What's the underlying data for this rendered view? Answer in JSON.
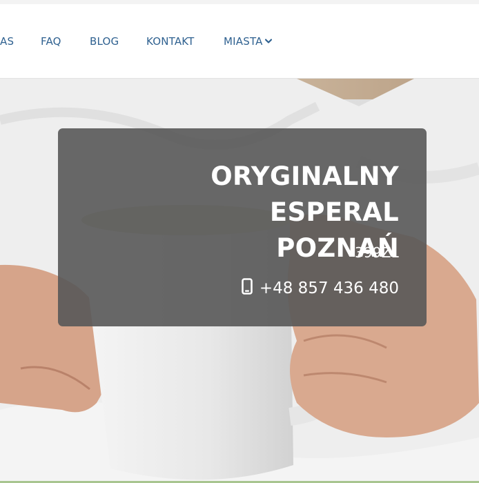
{
  "nav": {
    "items": [
      {
        "label": "AS"
      },
      {
        "label": "FAQ"
      },
      {
        "label": "BLOG"
      },
      {
        "label": "KONTAKT"
      },
      {
        "label": "MIASTA"
      }
    ]
  },
  "hero": {
    "title_line1": "ORYGINALNY ESPERAL",
    "title_line2": "POZNAŃ",
    "price": "399ZŁ",
    "phone": "+48 857 436 480"
  },
  "colors": {
    "nav_link": "#2f6190",
    "card_bg": "#5a5a5a",
    "accent_line": "#a8c58f"
  },
  "icons": {
    "dropdown": "chevron-down-icon",
    "phone": "mobile-phone-icon"
  }
}
